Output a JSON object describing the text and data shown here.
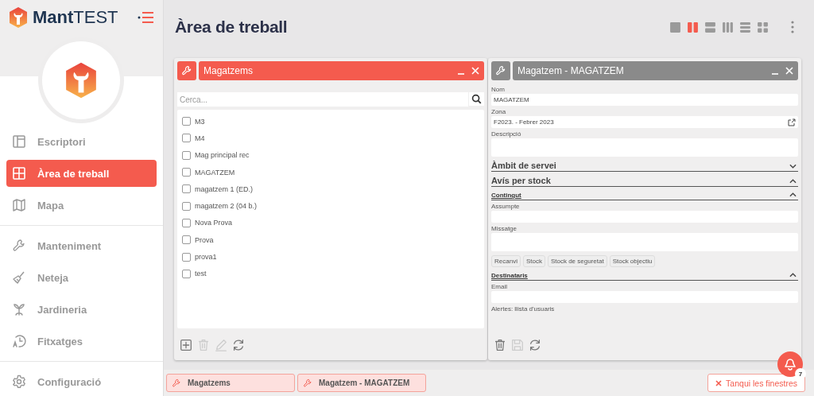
{
  "app": {
    "name_bold": "Mant",
    "name_light": "TEST"
  },
  "page_title": "Àrea de treball",
  "nav_groups": [
    [
      {
        "label": "Escriptori",
        "kind": "layout",
        "selected": false
      },
      {
        "label": "Àrea de treball",
        "kind": "grid",
        "selected": true
      },
      {
        "label": "Mapa",
        "kind": "map",
        "selected": false
      }
    ],
    [
      {
        "label": "Manteniment",
        "kind": "wrench",
        "selected": false
      },
      {
        "label": "Neteja",
        "kind": "brush",
        "selected": false
      },
      {
        "label": "Jardineria",
        "kind": "sprout",
        "selected": false
      },
      {
        "label": "Fitxatges",
        "kind": "clock",
        "selected": false
      }
    ],
    [
      {
        "label": "Configuració",
        "kind": "gear",
        "selected": false
      }
    ]
  ],
  "layouts": [
    {
      "kind": "single",
      "selected": false
    },
    {
      "kind": "two-columns",
      "selected": true
    },
    {
      "kind": "two-rows",
      "selected": false
    },
    {
      "kind": "three-columns",
      "selected": false
    },
    {
      "kind": "three-rows",
      "selected": false
    },
    {
      "kind": "grid",
      "selected": false
    }
  ],
  "windows": [
    {
      "kind": "list",
      "title": "Magatzems",
      "active": true,
      "search_placeholder": "Cerca...",
      "items": [
        {
          "label": "M3",
          "checked": false
        },
        {
          "label": "M4",
          "checked": false
        },
        {
          "label": "Mag principal rec",
          "checked": false
        },
        {
          "label": "MAGATZEM",
          "checked": false
        },
        {
          "label": "magatzem 1 (ED.)",
          "checked": false
        },
        {
          "label": "magatzem 2 (04 b.)",
          "checked": false
        },
        {
          "label": "Nova Prova",
          "checked": false
        },
        {
          "label": "Prova",
          "checked": false
        },
        {
          "label": "prova1",
          "checked": false
        },
        {
          "label": "test",
          "checked": false
        }
      ],
      "toolbar": [
        {
          "kind": "add",
          "disabled": false
        },
        {
          "kind": "delete",
          "disabled": true
        },
        {
          "kind": "edit",
          "disabled": true
        },
        {
          "kind": "refresh",
          "disabled": false
        }
      ]
    },
    {
      "kind": "form",
      "title": "Magatzem - MAGATZEM",
      "active": false,
      "rows": [
        {
          "kind": "input",
          "label": "Nom",
          "value": "MAGATZEM"
        },
        {
          "kind": "input",
          "label": "Zona",
          "value": "F2023. - Febrer 2023",
          "link": true
        },
        {
          "kind": "textarea",
          "label": "Descripció"
        },
        {
          "kind": "section",
          "title": "Àmbit de servei",
          "expanded": false
        },
        {
          "kind": "section",
          "title": "Avís per stock",
          "expanded": true
        },
        {
          "kind": "subsection",
          "title": "Contingut",
          "expanded": true
        },
        {
          "kind": "input",
          "label": "Assumpte"
        },
        {
          "kind": "textarea",
          "label": "Missatge"
        },
        {
          "kind": "tags",
          "tags": [
            "Recanvi",
            "Stock",
            "Stock de seguretat",
            "Stock objectiu"
          ]
        },
        {
          "kind": "subsection",
          "title": "Destinataris",
          "expanded": true
        },
        {
          "kind": "input",
          "label": "Email"
        },
        {
          "kind": "label",
          "label": "Alertes: llista d'usuaris"
        }
      ],
      "toolbar": [
        {
          "kind": "delete",
          "disabled": false
        },
        {
          "kind": "save",
          "disabled": true
        },
        {
          "kind": "refresh",
          "disabled": false
        }
      ]
    }
  ],
  "taskbar": {
    "windows": [
      {
        "title": "Magatzems"
      },
      {
        "title": "Magatzem - MAGATZEM"
      }
    ],
    "close_all": "Tanqui les finestres",
    "notifications": "7"
  }
}
